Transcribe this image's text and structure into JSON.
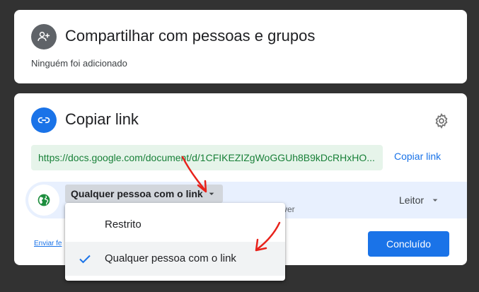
{
  "share_card": {
    "title": "Compartilhar com pessoas e grupos",
    "subtitle": "Ninguém foi adicionado",
    "icon": "add-person-icon"
  },
  "link_card": {
    "title": "Copiar link",
    "icon": "link-icon",
    "settings_icon": "gear-icon",
    "url": "https://docs.google.com/document/d/1CFIKEZIZgWoGGUh8B9kDcRHxHO...",
    "copy_label": "Copiar link",
    "access": {
      "selected": "Qualquer pessoa com o link",
      "description_visible": "ver",
      "icon": "globe-icon"
    },
    "role": "Leitor",
    "feedback_label": "Enviar fe",
    "done_label": "Concluído"
  },
  "dropdown": {
    "options": [
      {
        "label": "Restrito",
        "checked": false
      },
      {
        "label": "Qualquer pessoa com o link",
        "checked": true
      }
    ]
  },
  "colors": {
    "accent": "#1a73e8",
    "link_green": "#188038",
    "link_bg": "#e6f4ea",
    "annotation_red": "#e8221b",
    "globe_green": "#1e8e3e"
  }
}
